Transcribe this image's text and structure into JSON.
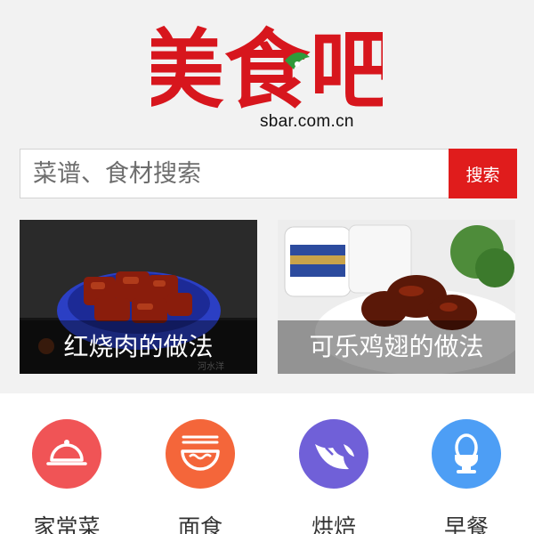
{
  "logo": {
    "text": "美食吧",
    "domain": "sbar.com.cn",
    "color": "#d7161d"
  },
  "search": {
    "placeholder": "菜谱、食材搜索",
    "value": "",
    "button_label": "搜索",
    "button_color": "#e01c1c"
  },
  "featured": [
    {
      "caption": "红烧肉的做法",
      "watermark": "河水洋"
    },
    {
      "caption": "可乐鸡翅的做法",
      "watermark": ""
    }
  ],
  "categories": [
    {
      "label": "家常菜",
      "icon": "cloche-icon",
      "color": "#f05456"
    },
    {
      "label": "面食",
      "icon": "noodle-bowl-icon",
      "color": "#f4663a"
    },
    {
      "label": "烘焙",
      "icon": "croissant-icon",
      "color": "#7060d8"
    },
    {
      "label": "早餐",
      "icon": "egg-cup-icon",
      "color": "#4d9ef5"
    }
  ]
}
